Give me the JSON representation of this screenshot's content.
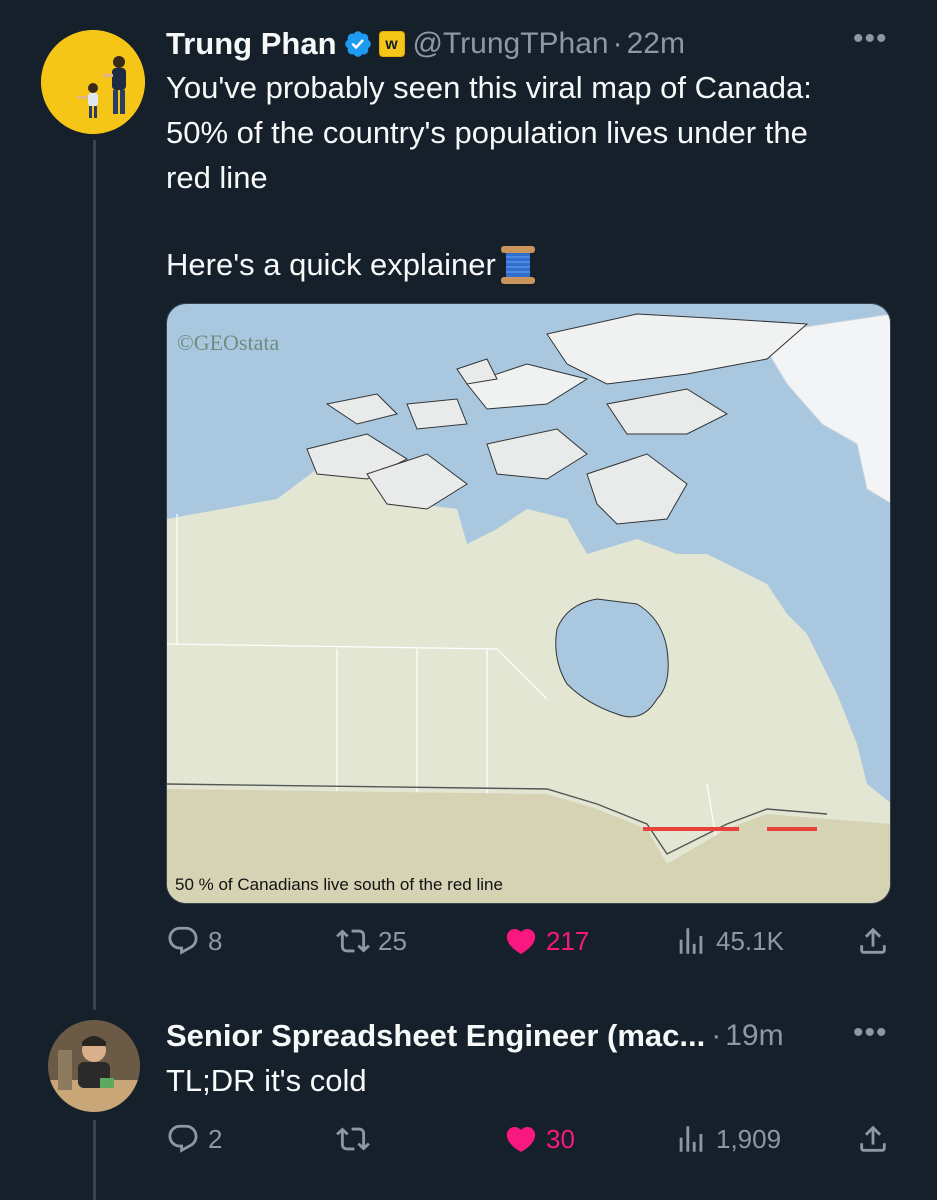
{
  "tweet": {
    "author_name": "Trung Phan",
    "handle": "@TrungTPhan",
    "dot": "·",
    "time": "22m",
    "affiliate_badge": "w",
    "text_lines": [
      "You've probably seen this viral map of Canada:",
      "50% of the country's population lives under the",
      "red line"
    ],
    "text_line2": "Here's a quick explainer",
    "emoji": "spool-of-thread-icon",
    "media": {
      "watermark": "©GEOstata",
      "caption": "50 % of Canadians live south of the red line"
    },
    "stats": {
      "replies": "8",
      "retweets": "25",
      "likes": "217",
      "views": "45.1K"
    }
  },
  "reply": {
    "author_name": "Senior Spreadsheet Engineer (mac...",
    "dot": "·",
    "time": "19m",
    "text": "TL;DR it's cold",
    "stats": {
      "replies": "2",
      "retweets": "",
      "likes": "30",
      "views": "1,909"
    }
  },
  "colors": {
    "background": "#15202b",
    "secondary_text": "#8b98a5",
    "like_pink": "#f91880",
    "verified_blue": "#1d9bf0",
    "avatar_yellow": "#f5c518",
    "red_line": "#e8423c"
  }
}
